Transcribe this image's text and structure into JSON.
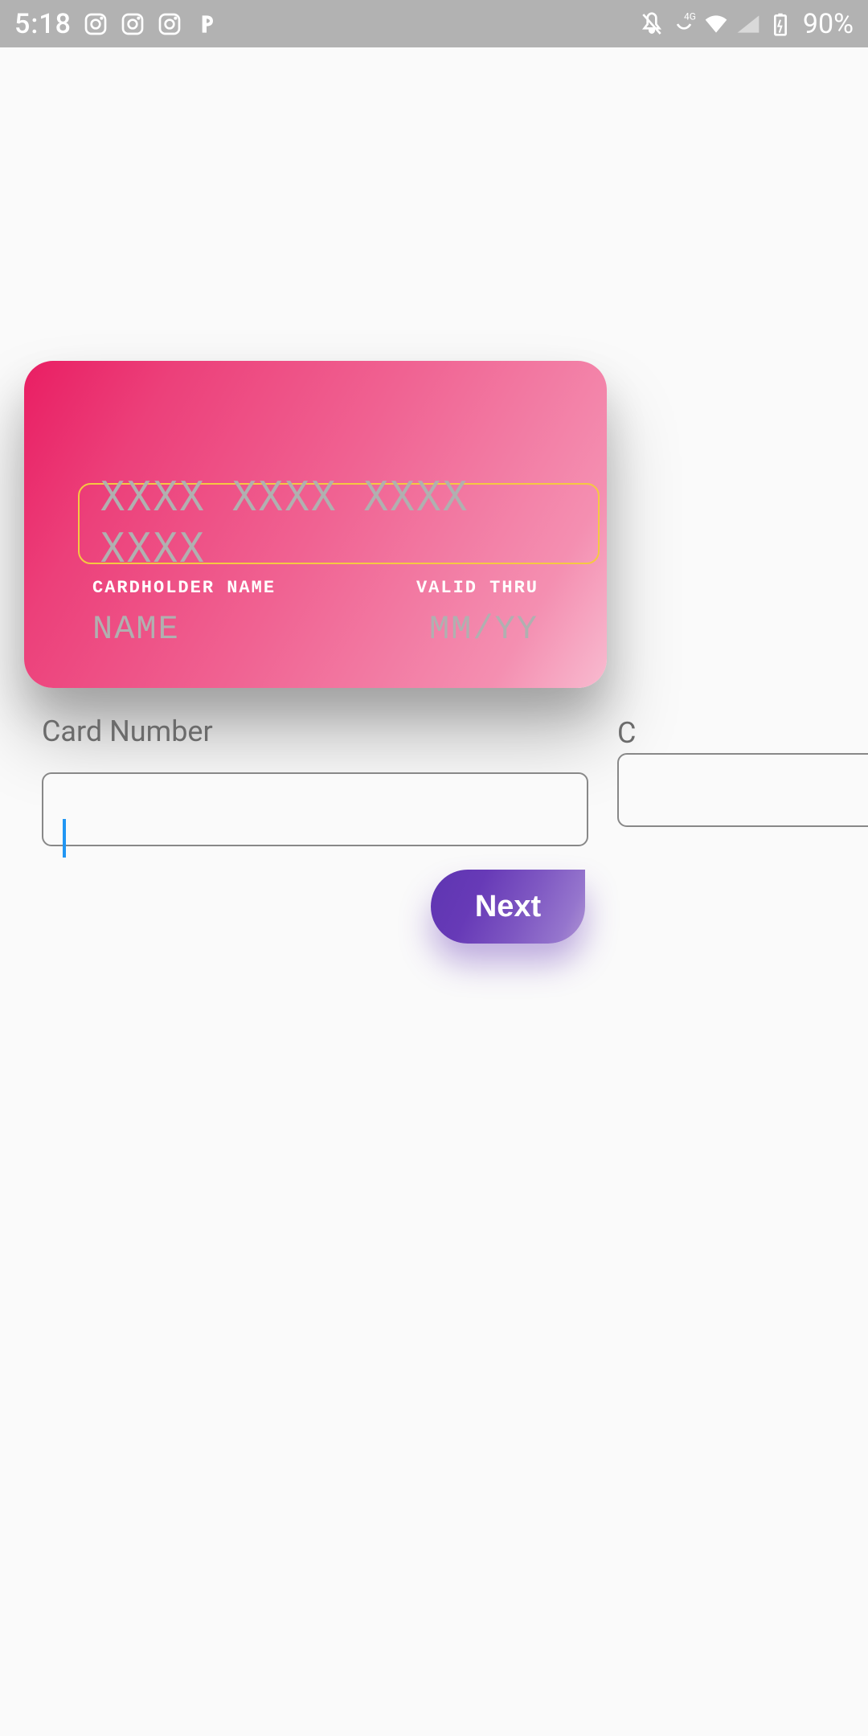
{
  "statusBar": {
    "time": "5:18",
    "battery": "90%",
    "networkType": "4G"
  },
  "card": {
    "numberPlaceholder": "XXXX  XXXX  XXXX  XXXX",
    "cardholderLabel": "CARDHOLDER NAME",
    "validThruLabel": "VALID THRU",
    "namePlaceholder": "NAME",
    "expiryPlaceholder": "MM/YY"
  },
  "form": {
    "cardNumberLabel": "Card Number",
    "cardNumberValue": "",
    "nextFieldPartialLabel": "C"
  },
  "buttons": {
    "next": "Next"
  }
}
